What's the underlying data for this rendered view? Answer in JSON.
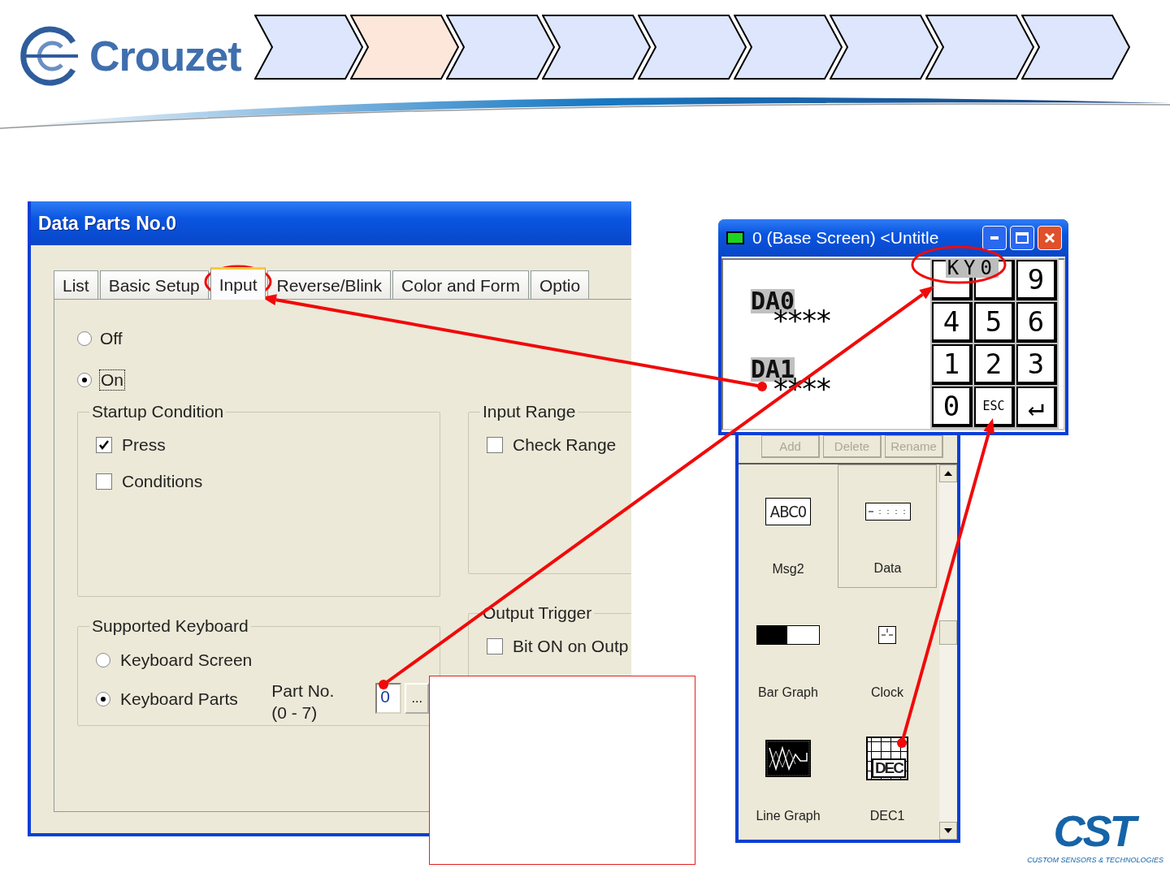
{
  "header": {
    "logo": "Crouzet",
    "steps": [
      {
        "selected": false
      },
      {
        "selected": true
      },
      {
        "selected": false
      },
      {
        "selected": false
      },
      {
        "selected": false
      },
      {
        "selected": false
      },
      {
        "selected": false
      },
      {
        "selected": false
      },
      {
        "selected": false
      }
    ]
  },
  "dialog": {
    "title": "Data Parts No.0",
    "tabs": [
      {
        "label": "List",
        "selected": false
      },
      {
        "label": "Basic Setup",
        "selected": false
      },
      {
        "label": "Input",
        "selected": true
      },
      {
        "label": "Reverse/Blink",
        "selected": false
      },
      {
        "label": "Color and Form",
        "selected": false
      },
      {
        "label": "Optio",
        "selected": false
      }
    ],
    "input_mode": [
      {
        "label": "Off",
        "selected": false,
        "focused": false
      },
      {
        "label": "On",
        "selected": true,
        "focused": true
      }
    ],
    "startup_condition": {
      "title": "Startup Condition",
      "options": [
        {
          "label": "Press",
          "checked": true
        },
        {
          "label": "Conditions",
          "checked": false
        }
      ]
    },
    "input_range": {
      "title": "Input Range",
      "options": [
        {
          "label": "Check Range",
          "checked": false
        }
      ]
    },
    "supported_keyboard": {
      "title": "Supported Keyboard",
      "options": [
        {
          "label": "Keyboard Screen",
          "selected": false
        },
        {
          "label": "Keyboard Parts",
          "selected": true
        }
      ],
      "part_no_label": "Part No.",
      "part_no_range": "(0 - 7)",
      "part_no": "0",
      "browse": "..."
    },
    "output_trigger": {
      "title": "Output Trigger",
      "options": [
        {
          "label": "Bit ON on Outp",
          "checked": false
        }
      ]
    }
  },
  "screen_window": {
    "title": "0 (Base Screen) <Untitle",
    "data_parts": [
      {
        "label": "DA0",
        "value": "****"
      },
      {
        "label": "DA1",
        "value": "****"
      }
    ],
    "keyboard_label": "KY0",
    "keys": [
      "9",
      "4",
      "5",
      "6",
      "1",
      "2",
      "3",
      "0",
      "ESC",
      "↵"
    ]
  },
  "parts_panel": {
    "buttons": [
      {
        "label": "Add",
        "disabled": true
      },
      {
        "label": "Delete",
        "disabled": true
      },
      {
        "label": "Rename",
        "disabled": true
      }
    ],
    "icon_texts": {
      "message": "ABC0",
      "keypad": "DEC"
    },
    "items": [
      {
        "label": "Msg2",
        "kind": "message",
        "selected": false
      },
      {
        "label": "Data",
        "kind": "data",
        "selected": true
      },
      {
        "label": "Bar Graph",
        "kind": "bar_graph",
        "selected": false
      },
      {
        "label": "Clock",
        "kind": "clock",
        "selected": false
      },
      {
        "label": "Line Graph",
        "kind": "line_graph",
        "selected": false
      },
      {
        "label": "DEC1",
        "kind": "keypad",
        "selected": false
      }
    ]
  },
  "footer_logo": {
    "name": "CST",
    "tagline": "CUSTOM SENSORS & TECHNOLOGIES"
  }
}
